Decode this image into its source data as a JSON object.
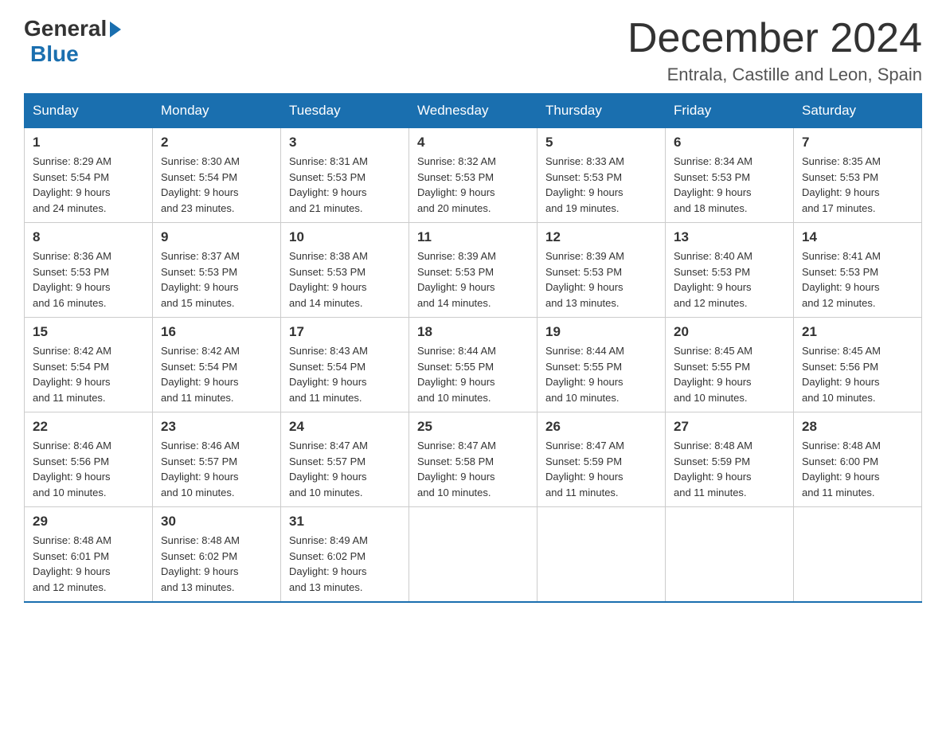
{
  "logo": {
    "general": "General",
    "blue": "Blue"
  },
  "header": {
    "month": "December 2024",
    "location": "Entrala, Castille and Leon, Spain"
  },
  "weekdays": [
    "Sunday",
    "Monday",
    "Tuesday",
    "Wednesday",
    "Thursday",
    "Friday",
    "Saturday"
  ],
  "weeks": [
    [
      {
        "day": "1",
        "sunrise": "8:29 AM",
        "sunset": "5:54 PM",
        "daylight": "9 hours and 24 minutes."
      },
      {
        "day": "2",
        "sunrise": "8:30 AM",
        "sunset": "5:54 PM",
        "daylight": "9 hours and 23 minutes."
      },
      {
        "day": "3",
        "sunrise": "8:31 AM",
        "sunset": "5:53 PM",
        "daylight": "9 hours and 21 minutes."
      },
      {
        "day": "4",
        "sunrise": "8:32 AM",
        "sunset": "5:53 PM",
        "daylight": "9 hours and 20 minutes."
      },
      {
        "day": "5",
        "sunrise": "8:33 AM",
        "sunset": "5:53 PM",
        "daylight": "9 hours and 19 minutes."
      },
      {
        "day": "6",
        "sunrise": "8:34 AM",
        "sunset": "5:53 PM",
        "daylight": "9 hours and 18 minutes."
      },
      {
        "day": "7",
        "sunrise": "8:35 AM",
        "sunset": "5:53 PM",
        "daylight": "9 hours and 17 minutes."
      }
    ],
    [
      {
        "day": "8",
        "sunrise": "8:36 AM",
        "sunset": "5:53 PM",
        "daylight": "9 hours and 16 minutes."
      },
      {
        "day": "9",
        "sunrise": "8:37 AM",
        "sunset": "5:53 PM",
        "daylight": "9 hours and 15 minutes."
      },
      {
        "day": "10",
        "sunrise": "8:38 AM",
        "sunset": "5:53 PM",
        "daylight": "9 hours and 14 minutes."
      },
      {
        "day": "11",
        "sunrise": "8:39 AM",
        "sunset": "5:53 PM",
        "daylight": "9 hours and 14 minutes."
      },
      {
        "day": "12",
        "sunrise": "8:39 AM",
        "sunset": "5:53 PM",
        "daylight": "9 hours and 13 minutes."
      },
      {
        "day": "13",
        "sunrise": "8:40 AM",
        "sunset": "5:53 PM",
        "daylight": "9 hours and 12 minutes."
      },
      {
        "day": "14",
        "sunrise": "8:41 AM",
        "sunset": "5:53 PM",
        "daylight": "9 hours and 12 minutes."
      }
    ],
    [
      {
        "day": "15",
        "sunrise": "8:42 AM",
        "sunset": "5:54 PM",
        "daylight": "9 hours and 11 minutes."
      },
      {
        "day": "16",
        "sunrise": "8:42 AM",
        "sunset": "5:54 PM",
        "daylight": "9 hours and 11 minutes."
      },
      {
        "day": "17",
        "sunrise": "8:43 AM",
        "sunset": "5:54 PM",
        "daylight": "9 hours and 11 minutes."
      },
      {
        "day": "18",
        "sunrise": "8:44 AM",
        "sunset": "5:55 PM",
        "daylight": "9 hours and 10 minutes."
      },
      {
        "day": "19",
        "sunrise": "8:44 AM",
        "sunset": "5:55 PM",
        "daylight": "9 hours and 10 minutes."
      },
      {
        "day": "20",
        "sunrise": "8:45 AM",
        "sunset": "5:55 PM",
        "daylight": "9 hours and 10 minutes."
      },
      {
        "day": "21",
        "sunrise": "8:45 AM",
        "sunset": "5:56 PM",
        "daylight": "9 hours and 10 minutes."
      }
    ],
    [
      {
        "day": "22",
        "sunrise": "8:46 AM",
        "sunset": "5:56 PM",
        "daylight": "9 hours and 10 minutes."
      },
      {
        "day": "23",
        "sunrise": "8:46 AM",
        "sunset": "5:57 PM",
        "daylight": "9 hours and 10 minutes."
      },
      {
        "day": "24",
        "sunrise": "8:47 AM",
        "sunset": "5:57 PM",
        "daylight": "9 hours and 10 minutes."
      },
      {
        "day": "25",
        "sunrise": "8:47 AM",
        "sunset": "5:58 PM",
        "daylight": "9 hours and 10 minutes."
      },
      {
        "day": "26",
        "sunrise": "8:47 AM",
        "sunset": "5:59 PM",
        "daylight": "9 hours and 11 minutes."
      },
      {
        "day": "27",
        "sunrise": "8:48 AM",
        "sunset": "5:59 PM",
        "daylight": "9 hours and 11 minutes."
      },
      {
        "day": "28",
        "sunrise": "8:48 AM",
        "sunset": "6:00 PM",
        "daylight": "9 hours and 11 minutes."
      }
    ],
    [
      {
        "day": "29",
        "sunrise": "8:48 AM",
        "sunset": "6:01 PM",
        "daylight": "9 hours and 12 minutes."
      },
      {
        "day": "30",
        "sunrise": "8:48 AM",
        "sunset": "6:02 PM",
        "daylight": "9 hours and 13 minutes."
      },
      {
        "day": "31",
        "sunrise": "8:49 AM",
        "sunset": "6:02 PM",
        "daylight": "9 hours and 13 minutes."
      },
      null,
      null,
      null,
      null
    ]
  ],
  "labels": {
    "sunrise": "Sunrise:",
    "sunset": "Sunset:",
    "daylight": "Daylight:"
  }
}
